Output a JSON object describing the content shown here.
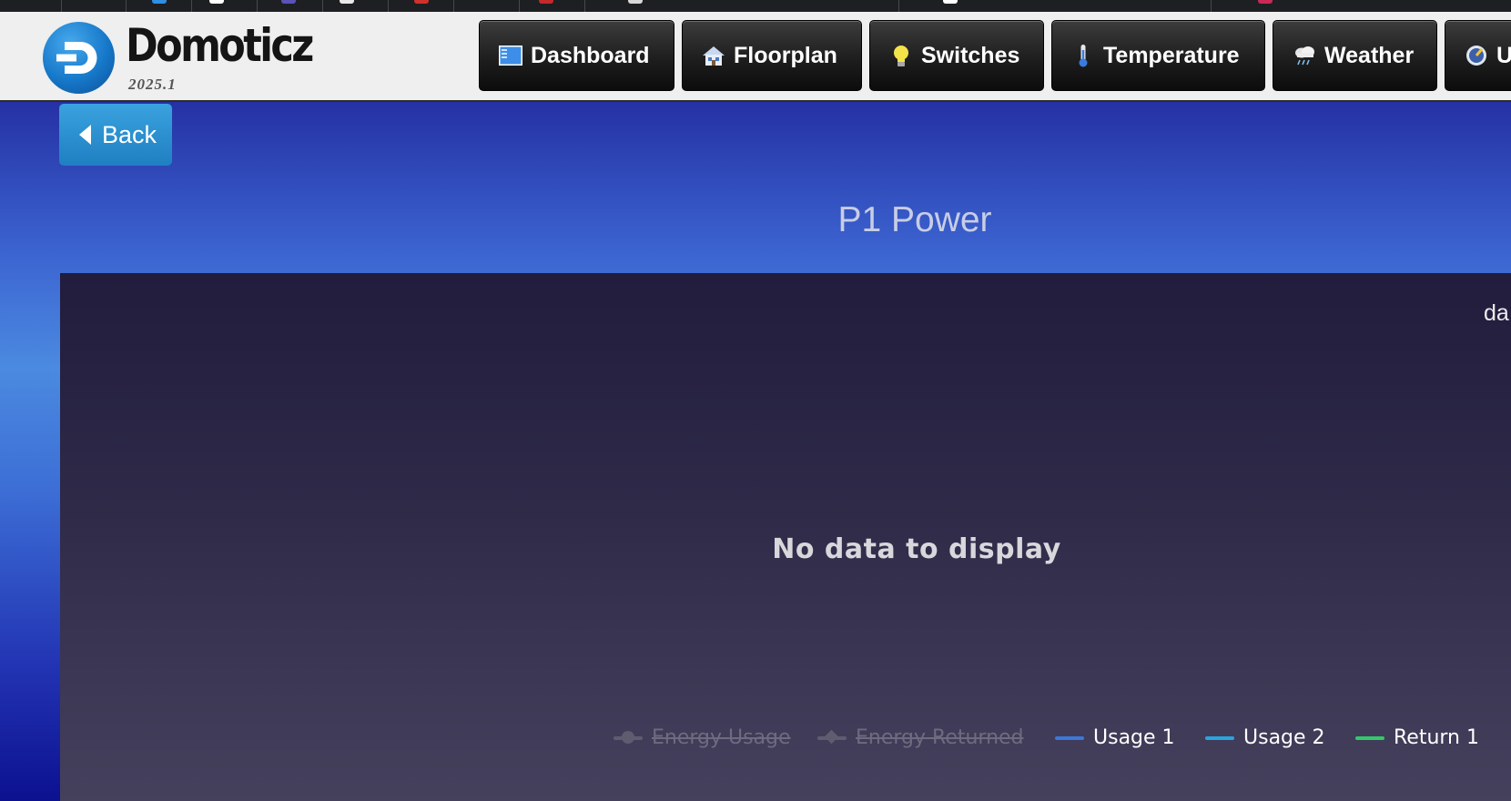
{
  "app": {
    "brand": "Domoticz",
    "version": "2025.1"
  },
  "nav": [
    {
      "label": "Dashboard",
      "icon": "dashboard-icon"
    },
    {
      "label": "Floorplan",
      "icon": "house-icon"
    },
    {
      "label": "Switches",
      "icon": "lightbulb-icon"
    },
    {
      "label": "Temperature",
      "icon": "thermometer-icon"
    },
    {
      "label": "Weather",
      "icon": "rain-cloud-icon"
    },
    {
      "label": "U",
      "icon": "gauge-icon"
    }
  ],
  "page": {
    "back_label": "Back",
    "title": "P1 Power"
  },
  "chart": {
    "range_label": "da",
    "empty_message": "No data to display",
    "legend": [
      {
        "name": "Energy Usage",
        "color": "#5f5c70",
        "visible": false
      },
      {
        "name": "Energy Returned",
        "color": "#5f5c70",
        "visible": false
      },
      {
        "name": "Usage 1",
        "color": "#3a78d8",
        "visible": true
      },
      {
        "name": "Usage 2",
        "color": "#2aa5e0",
        "visible": true
      },
      {
        "name": "Return 1",
        "color": "#33c86a",
        "visible": true
      }
    ]
  },
  "chart_data": {
    "type": "line",
    "series": [
      {
        "name": "Energy Usage",
        "values": []
      },
      {
        "name": "Energy Returned",
        "values": []
      },
      {
        "name": "Usage 1",
        "values": []
      },
      {
        "name": "Usage 2",
        "values": []
      },
      {
        "name": "Return 1",
        "values": []
      }
    ],
    "legend": "bottom-right"
  },
  "colors": {
    "header_bg": "#efefef",
    "nav_button": "#1e1e1e",
    "back_button": "#2a8fd0",
    "chart_bg": "#2e2a48"
  }
}
